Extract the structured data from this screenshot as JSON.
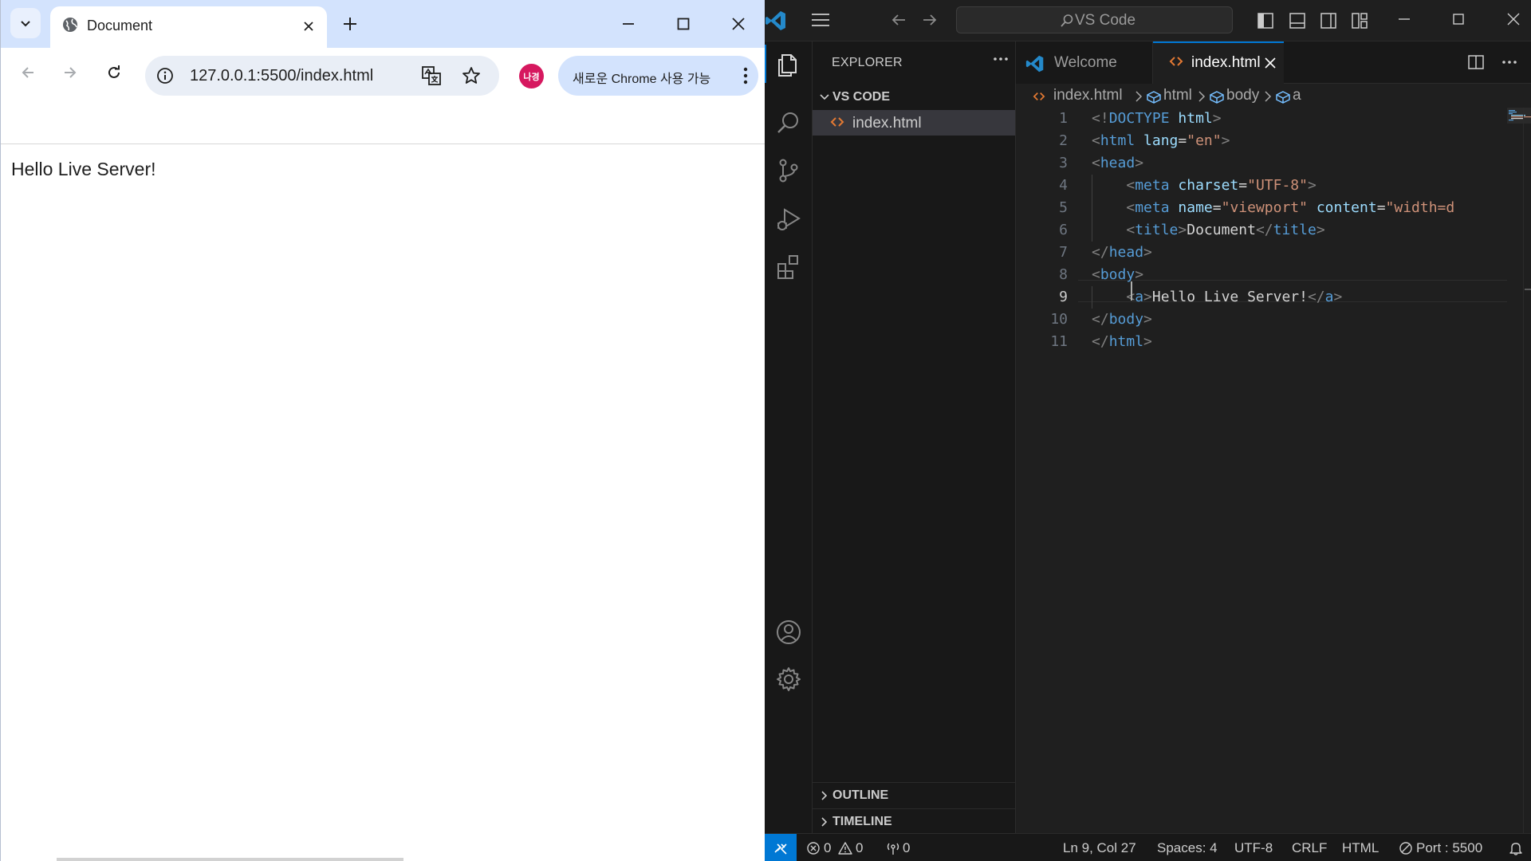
{
  "browser": {
    "tab": {
      "title": "Document"
    },
    "omnibox": {
      "url": "127.0.0.1:5500/index.html"
    },
    "profile": {
      "initials": "나경"
    },
    "update_button": {
      "label": "새로운 Chrome 사용 가능"
    },
    "page": {
      "text": "Hello Live Server!"
    }
  },
  "vscode": {
    "command_center": {
      "label": "VS Code"
    },
    "explorer": {
      "title": "EXPLORER",
      "folder": "VS CODE",
      "files": [
        "index.html"
      ],
      "outline_label": "OUTLINE",
      "timeline_label": "TIMELINE"
    },
    "tabs": [
      {
        "label": "Welcome",
        "active": false
      },
      {
        "label": "index.html",
        "active": true
      }
    ],
    "breadcrumbs": [
      "index.html",
      "html",
      "body",
      "a"
    ],
    "line_numbers": [
      "1",
      "2",
      "3",
      "4",
      "5",
      "6",
      "7",
      "8",
      "9",
      "10",
      "11"
    ],
    "active_line": 9,
    "code": {
      "l1": {
        "open": "<!",
        "kw": "DOCTYPE",
        "attr": "html",
        "close": ">"
      },
      "l2": {
        "open": "<",
        "tag": "html",
        "attr": "lang",
        "eq": "=",
        "val": "\"en\"",
        "close": ">"
      },
      "l3": {
        "open": "<",
        "tag": "head",
        "close": ">"
      },
      "l4": {
        "open": "<",
        "tag": "meta",
        "attr": "charset",
        "eq": "=",
        "val": "\"UTF-8\"",
        "close": ">"
      },
      "l5": {
        "open": "<",
        "tag": "meta",
        "attr": "name",
        "eq": "=",
        "val": "\"viewport\"",
        "attr2": "content",
        "eq2": "=",
        "val2": "\"width=d"
      },
      "l6": {
        "open": "<",
        "tag": "title",
        "close": ">",
        "text": "Document",
        "open2": "</",
        "tag2": "title",
        "close2": ">"
      },
      "l7": {
        "open": "</",
        "tag": "head",
        "close": ">"
      },
      "l8": {
        "open": "<",
        "tag": "body",
        "close": ">"
      },
      "l9": {
        "open": "<",
        "tag": "a",
        "close": ">",
        "text": "Hello Live Server!",
        "open2": "</",
        "tag2": "a",
        "close2": ">"
      },
      "l10": {
        "open": "</",
        "tag": "body",
        "close": ">"
      },
      "l11": {
        "open": "</",
        "tag": "html",
        "close": ">"
      }
    },
    "status": {
      "errors": "0",
      "warnings": "0",
      "ports": "0",
      "position": "Ln 9, Col 27",
      "spaces": "Spaces: 4",
      "encoding": "UTF-8",
      "eol": "CRLF",
      "language": "HTML",
      "live_server": "Port : 5500"
    },
    "colors": {
      "accent": "#0078d4",
      "tag": "#569cd6",
      "attr": "#9cdcfe",
      "string": "#ce9178",
      "html_icon": "#e37933"
    }
  }
}
